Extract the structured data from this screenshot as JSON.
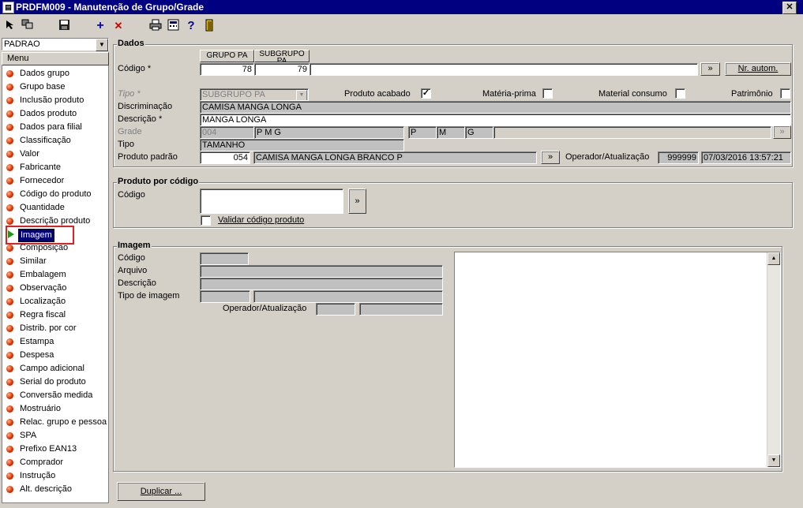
{
  "window": {
    "title": "PRDFM009 - Manutenção de Grupo/Grade",
    "close": "✕"
  },
  "toolbar": {
    "add": "+",
    "delete": "✕",
    "help": "?"
  },
  "profile": {
    "value": "PADRAO"
  },
  "menu": {
    "header": "Menu",
    "items": [
      "Dados grupo",
      "Grupo base",
      "Inclusão produto",
      "Dados produto",
      "Dados para filial",
      "Classificação",
      "Valor",
      "Fabricante",
      "Fornecedor",
      "Código do produto",
      "Quantidade",
      "Descrição produto",
      "Imagem",
      "Composição",
      "Similar",
      "Embalagem",
      "Observação",
      "Localização",
      "Regra fiscal",
      "Distrib. por cor",
      "Estampa",
      "Despesa",
      "Campo adicional",
      "Serial do produto",
      "Conversão medida",
      "Mostruário",
      "Relac. grupo e pessoa",
      "SPA",
      "Prefixo EAN13",
      "Comprador",
      "Instrução",
      "Alt. descrição"
    ]
  },
  "dados": {
    "title": "Dados",
    "col_grupo": "GRUPO PA",
    "col_subgrupo": "SUBGRUPO PA",
    "codigo_label": "Código *",
    "grupo_value": "78",
    "subgrupo_value": "79",
    "goto": "»",
    "nr_autom": "Nr. autom.",
    "tipo_label": "Tipo *",
    "tipo_value": "SUBGRUPO PA",
    "produto_acabado": "Produto acabado",
    "materia_prima": "Matéria-prima",
    "material_consumo": "Material consumo",
    "patrimonio": "Patrimônio",
    "check_mark": "✓",
    "discriminacao_label": "Discriminação",
    "discriminacao_value": "CAMISA MANGA LONGA",
    "descricao_label": "Descrição *",
    "descricao_value": "MANGA LONGA",
    "grade_label": "Grade",
    "grade_code": "004",
    "grade_desc": "P M G",
    "grade_p": "P",
    "grade_m": "M",
    "grade_g": "G",
    "tipo2_label": "Tipo",
    "tipo2_value": "TAMANHO",
    "produto_padrao_label": "Produto padrão",
    "produto_padrao_code": "054",
    "produto_padrao_desc": "CAMISA MANGA LONGA BRANCO P",
    "operador_label": "Operador/Atualização",
    "operador_value": "999999",
    "data_value": "07/03/2016 13:57:21"
  },
  "produto_codigo": {
    "title": "Produto por código",
    "codigo_label": "Código",
    "validar_label": "Validar código produto"
  },
  "imagem": {
    "title": "Imagem",
    "codigo_label": "Código",
    "arquivo_label": "Arquivo",
    "descricao_label": "Descrição",
    "tipo_label": "Tipo de imagem",
    "operador_label": "Operador/Atualização"
  },
  "footer": {
    "duplicar": "Duplicar ..."
  }
}
